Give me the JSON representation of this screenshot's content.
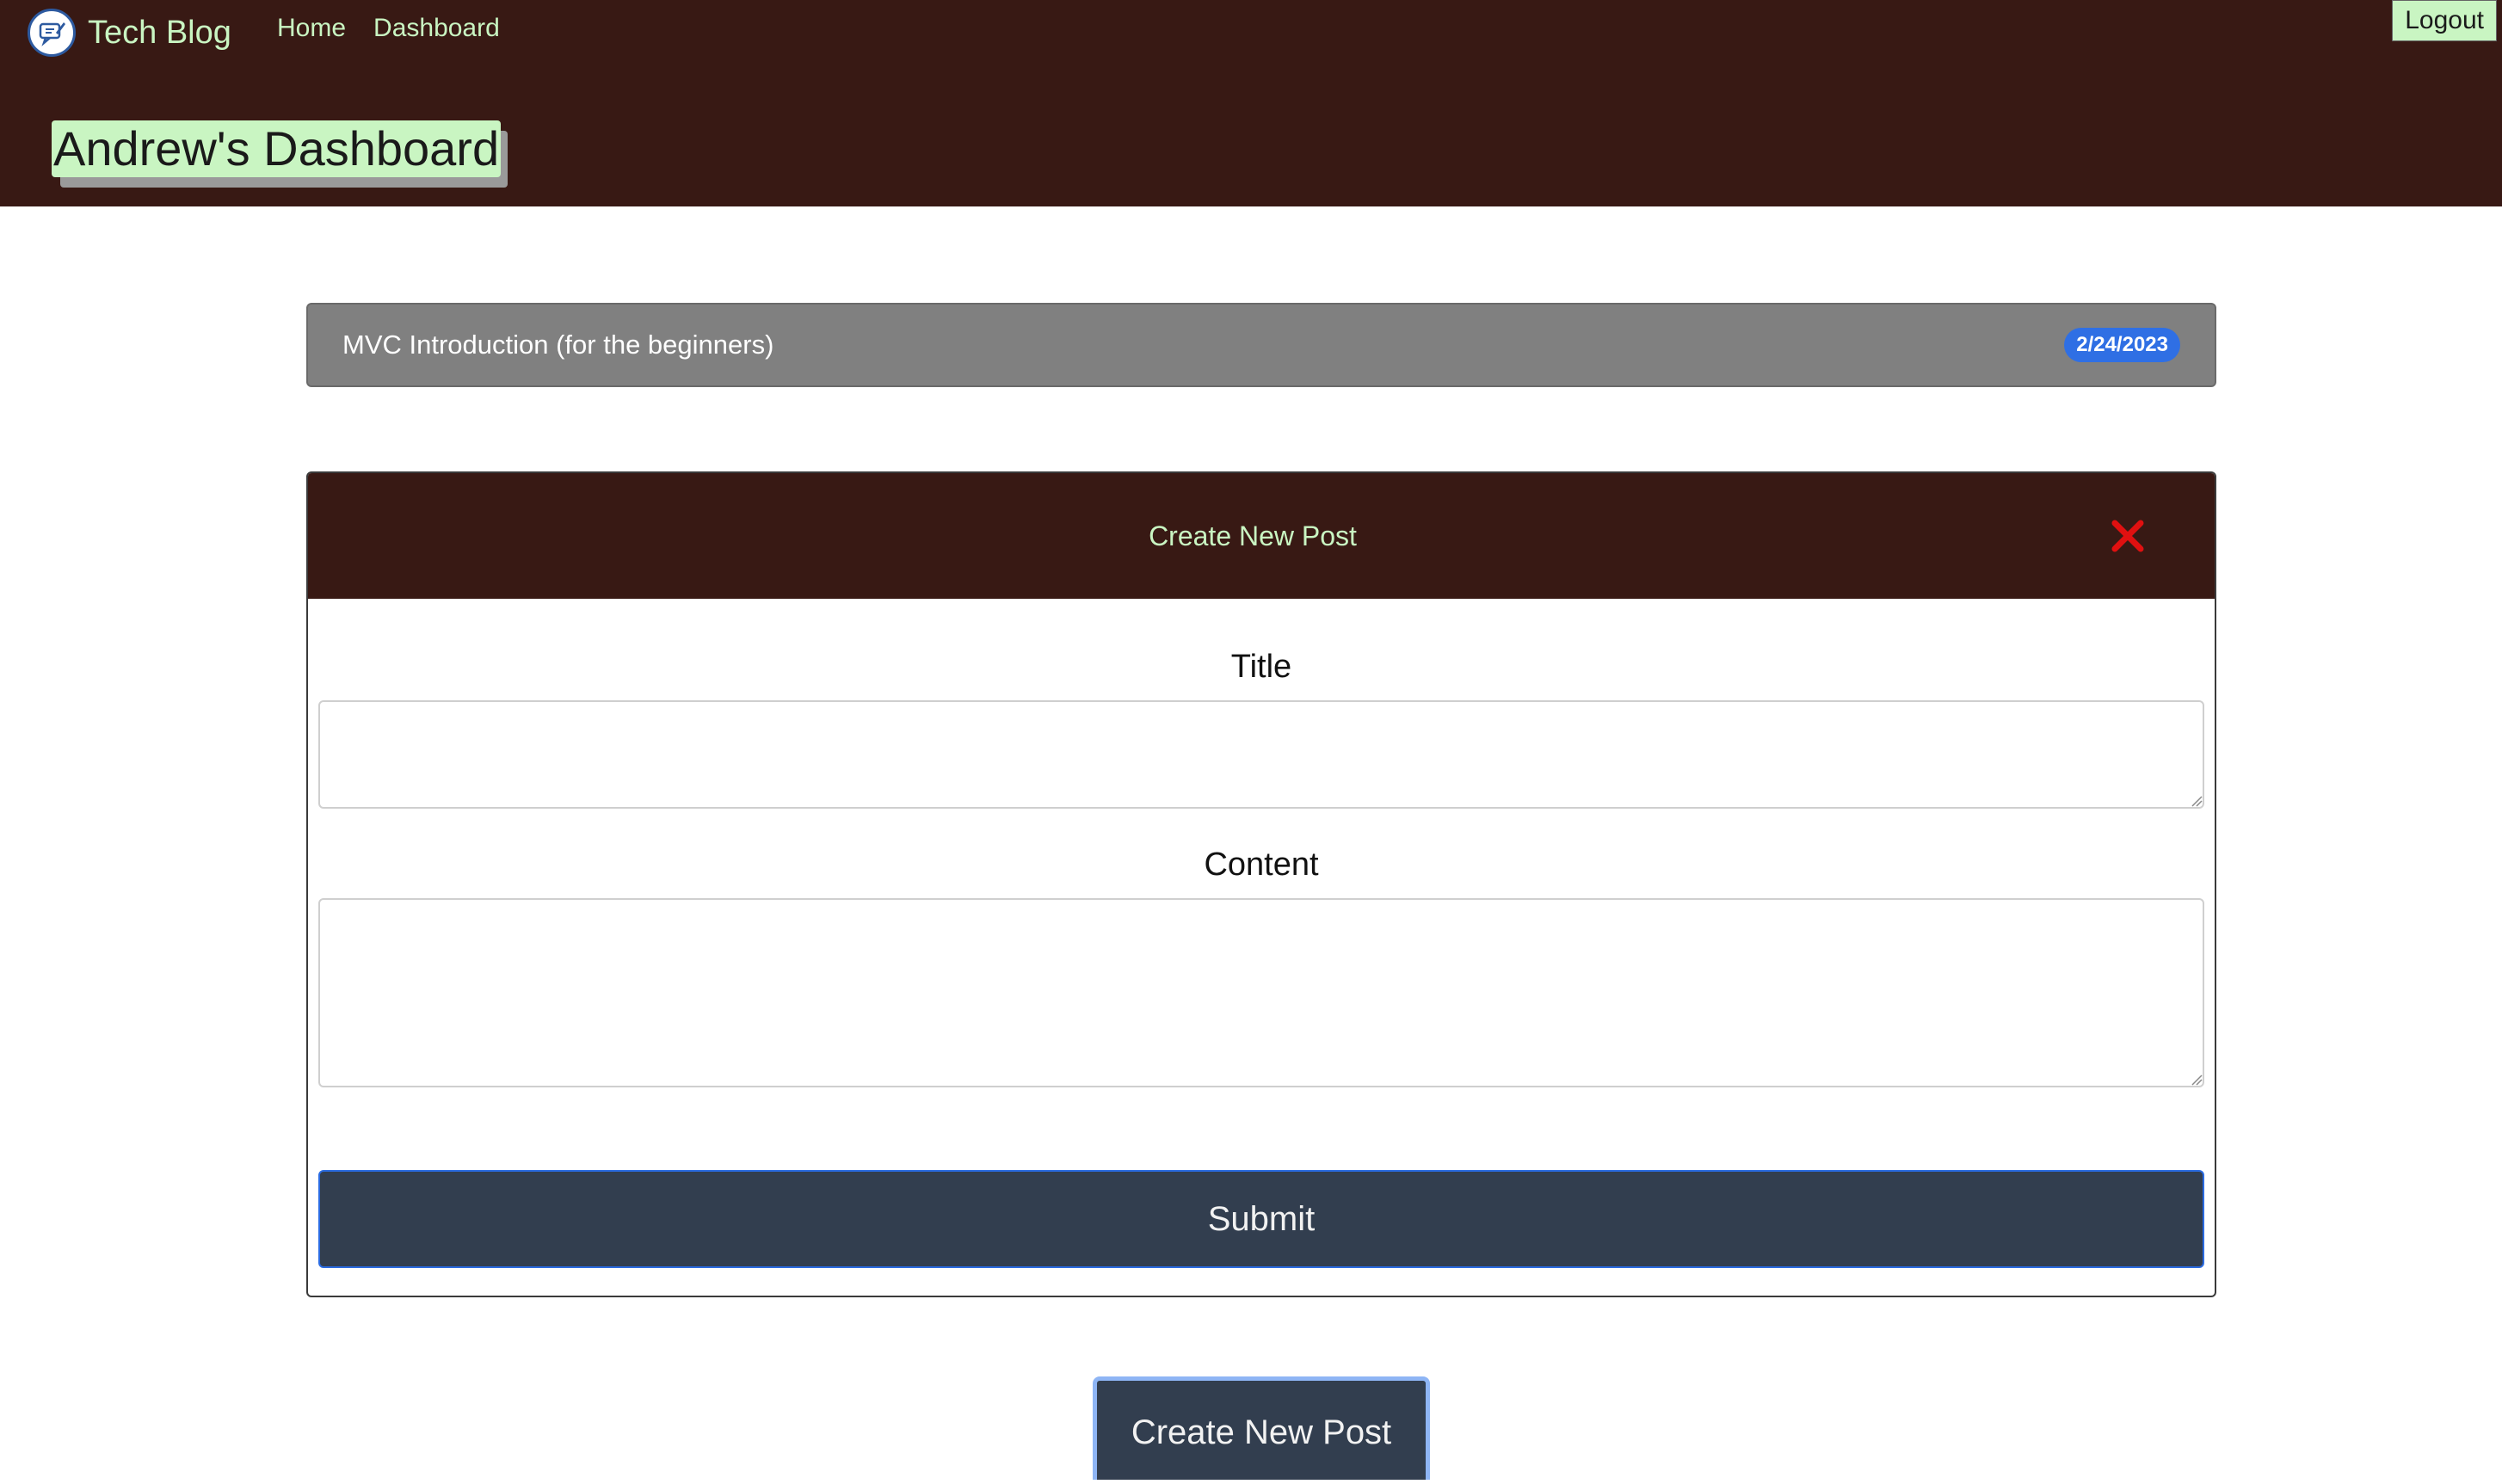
{
  "header": {
    "brand_name": "Tech Blog",
    "nav": {
      "home": "Home",
      "dashboard": "Dashboard"
    },
    "logout_label": "Logout",
    "dashboard_title": "Andrew's Dashboard"
  },
  "posts": [
    {
      "title": "MVC Introduction (for the beginners)",
      "date": "2/24/2023"
    }
  ],
  "new_post_form": {
    "heading": "Create New Post",
    "title_label": "Title",
    "title_value": "",
    "content_label": "Content",
    "content_value": "",
    "submit_label": "Submit"
  },
  "create_button_label": "Create New Post",
  "colors": {
    "header_bg": "#381914",
    "accent_green": "#c9f5c2",
    "button_bg": "#323e4f",
    "date_badge": "#2f6fe4",
    "close_red": "#e01010"
  },
  "icons": {
    "brand": "chat-pencil-icon",
    "close": "close-icon"
  }
}
